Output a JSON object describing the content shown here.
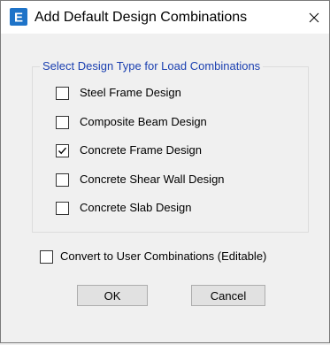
{
  "window": {
    "title": "Add Default Design Combinations",
    "app_icon_letter": "E",
    "accent_color": "#1e73c8"
  },
  "group": {
    "legend": "Select Design Type for Load Combinations",
    "legend_color": "#1a3fb0",
    "options": [
      {
        "label": "Steel Frame Design",
        "checked": false
      },
      {
        "label": "Composite Beam Design",
        "checked": false
      },
      {
        "label": "Concrete Frame Design",
        "checked": true
      },
      {
        "label": "Concrete Shear Wall Design",
        "checked": false
      },
      {
        "label": "Concrete Slab Design",
        "checked": false
      }
    ]
  },
  "convert": {
    "label": "Convert to User Combinations (Editable)",
    "checked": false
  },
  "buttons": {
    "ok_label": "OK",
    "cancel_label": "Cancel"
  }
}
